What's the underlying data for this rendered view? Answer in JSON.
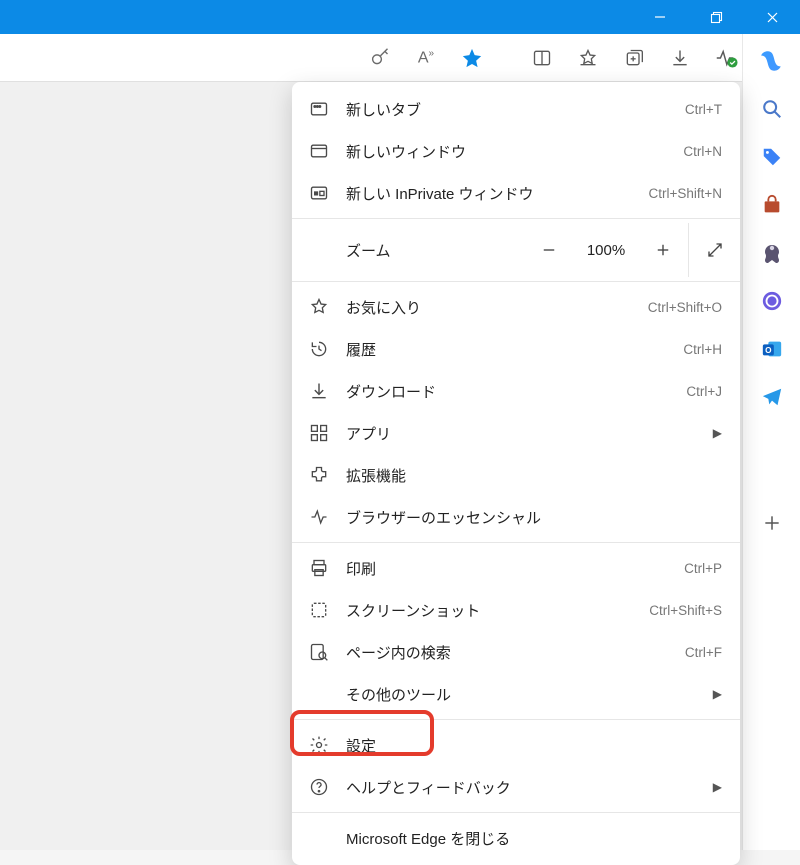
{
  "titlebar": {
    "minimize": "—",
    "maximize": "❐",
    "close": "✕"
  },
  "toolbar": {
    "password_icon": "password",
    "read_aloud_icon": "read-aloud",
    "favorite_star_icon": "favorite",
    "split_icon": "split",
    "favorites_icon": "favorites",
    "collections_icon": "collections",
    "downloads_icon": "downloads",
    "performance_icon": "performance",
    "more_icon": "more"
  },
  "menu": {
    "new_tab": {
      "label": "新しいタブ",
      "shortcut": "Ctrl+T"
    },
    "new_window": {
      "label": "新しいウィンドウ",
      "shortcut": "Ctrl+N"
    },
    "new_inprivate": {
      "label": "新しい InPrivate ウィンドウ",
      "shortcut": "Ctrl+Shift+N"
    },
    "zoom": {
      "label": "ズーム",
      "value": "100%"
    },
    "favorites": {
      "label": "お気に入り",
      "shortcut": "Ctrl+Shift+O"
    },
    "history": {
      "label": "履歴",
      "shortcut": "Ctrl+H"
    },
    "downloads": {
      "label": "ダウンロード",
      "shortcut": "Ctrl+J"
    },
    "apps": {
      "label": "アプリ"
    },
    "extensions": {
      "label": "拡張機能"
    },
    "essentials": {
      "label": "ブラウザーのエッセンシャル"
    },
    "print": {
      "label": "印刷",
      "shortcut": "Ctrl+P"
    },
    "screenshot": {
      "label": "スクリーンショット",
      "shortcut": "Ctrl+Shift+S"
    },
    "find": {
      "label": "ページ内の検索",
      "shortcut": "Ctrl+F"
    },
    "more_tools": {
      "label": "その他のツール"
    },
    "settings": {
      "label": "設定"
    },
    "help": {
      "label": "ヘルプとフィードバック"
    },
    "close_edge": {
      "label": "Microsoft Edge を閉じる"
    }
  },
  "sidebar": {
    "copilot": "copilot",
    "search": "search",
    "tags": "tags",
    "shopping": "shopping",
    "games": "games",
    "office": "office",
    "outlook": "outlook",
    "telegram": "telegram",
    "add": "add"
  }
}
